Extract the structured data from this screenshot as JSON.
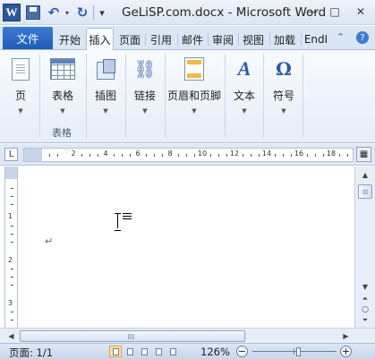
{
  "window": {
    "title": "GeLiSP.com.docx - Microsoft Word",
    "app_icon_letter": "W",
    "controls": {
      "minimize": "—",
      "maximize": "□",
      "close": "✕"
    }
  },
  "quick_access": {
    "undo": "↶",
    "redo": "↻",
    "customize": "▾"
  },
  "tabs": {
    "file": "文件",
    "items": [
      "开始",
      "插入",
      "页面",
      "引用",
      "邮件",
      "审阅",
      "视图",
      "加载",
      "EndI"
    ],
    "active_index": 1,
    "minimize_ribbon": "⌃",
    "help": "?"
  },
  "ribbon": {
    "groups": [
      {
        "group_label": "",
        "buttons": [
          {
            "label": "页",
            "icon": "page-icon"
          }
        ]
      },
      {
        "group_label": "表格",
        "buttons": [
          {
            "label": "表格",
            "icon": "table-icon"
          }
        ]
      },
      {
        "group_label": "",
        "buttons": [
          {
            "label": "插图",
            "icon": "picture-icon"
          }
        ]
      },
      {
        "group_label": "",
        "buttons": [
          {
            "label": "链接",
            "icon": "link-icon"
          }
        ]
      },
      {
        "group_label": "",
        "buttons": [
          {
            "label": "页眉和页脚",
            "icon": "header-footer-icon"
          }
        ]
      },
      {
        "group_label": "",
        "buttons": [
          {
            "label": "文本",
            "icon": "text-icon"
          }
        ]
      },
      {
        "group_label": "",
        "buttons": [
          {
            "label": "符号",
            "icon": "symbol-icon"
          }
        ]
      }
    ]
  },
  "ruler": {
    "tab_selector": "L",
    "numbers": [
      "2",
      "4",
      "6",
      "8",
      "10",
      "12",
      "14",
      "16",
      "18"
    ],
    "vertical_numbers": [
      "1",
      "2",
      "3"
    ]
  },
  "document": {
    "paragraph_mark": "↵"
  },
  "statusbar": {
    "page": "页面: 1/1",
    "zoom_level": "126%",
    "zoom_minus": "−",
    "zoom_plus": "+",
    "zoom_fraction": 0.55
  },
  "colors": {
    "file_tab": "#2a6ac8",
    "ribbon_bg": "#eef3fa",
    "accent": "#2d5aa6"
  }
}
